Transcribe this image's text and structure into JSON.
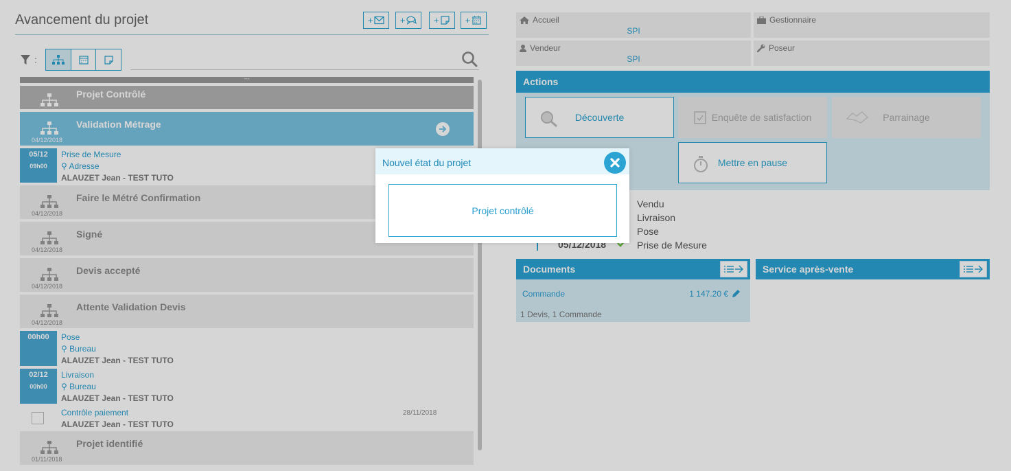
{
  "header": {
    "title": "Avancement du projet",
    "add_buttons": [
      {
        "plus": "+",
        "icon": "envelope-icon"
      },
      {
        "plus": "+",
        "icon": "chat-icon"
      },
      {
        "plus": "+",
        "icon": "note-icon"
      },
      {
        "plus": "+",
        "icon": "calendar-icon"
      }
    ]
  },
  "filter": {
    "colon": ":",
    "options": [
      "sitemap-icon",
      "calendar-icon",
      "note-icon"
    ]
  },
  "timeline": {
    "drag_handle": "---",
    "states": [
      {
        "name": "Projet Contrôlé",
        "date": ""
      },
      {
        "name": "Validation Métrage",
        "date": "04/12/2018"
      },
      {
        "name": "Faire le Métré Confirmation",
        "date": "04/12/2018"
      },
      {
        "name": "Signé",
        "date": "04/12/2018"
      },
      {
        "name": "Devis accepté",
        "date": "04/12/2018"
      },
      {
        "name": "Attente Validation Devis",
        "date": "04/12/2018"
      },
      {
        "name": "Projet identifié",
        "date": "01/11/2018"
      }
    ],
    "tasks": [
      {
        "date": "05/12",
        "time": "09h00",
        "title": "Prise de Mesure",
        "location": "Adresse",
        "person": "ALAUZET Jean - TEST TUTO"
      },
      {
        "date": "",
        "time": "00h00",
        "title": "Pose",
        "location": "Bureau",
        "person": "ALAUZET Jean - TEST TUTO"
      },
      {
        "date": "02/12",
        "time": "00h00",
        "title": "Livraison",
        "location": "Bureau",
        "person": "ALAUZET Jean - TEST TUTO"
      },
      {
        "title": "Contrôle paiement",
        "person": "ALAUZET Jean - TEST TUTO",
        "due": "28/11/2018"
      }
    ]
  },
  "info": {
    "accueil": {
      "label": "Accueil",
      "value": "SPI"
    },
    "gestionnaire": {
      "label": "Gestionnaire",
      "value": ""
    },
    "vendeur": {
      "label": "Vendeur",
      "value": "SPI"
    },
    "poseur": {
      "label": "Poseur",
      "value": ""
    }
  },
  "actions": {
    "title": "Actions",
    "buttons": [
      "Découverte",
      "Enquête de satisfaction",
      "Parrainage",
      "Mettre en pause"
    ]
  },
  "history": {
    "items": [
      "Vendu",
      "Livraison",
      "Pose",
      "Prise de Mesure"
    ],
    "last_date": "05/12/2018"
  },
  "documents": {
    "title": "Documents",
    "item_label": "Commande",
    "item_amount": "1 147.20 €",
    "summary": "1 Devis, 1 Commande"
  },
  "sav": {
    "title": "Service après-vente"
  },
  "modal": {
    "title": "Nouvel état du projet",
    "option": "Projet contrôlé"
  },
  "colors": {
    "accent": "#2ba4d4",
    "active_state": "#79c1e1",
    "task_date": "#4aa9d2"
  }
}
